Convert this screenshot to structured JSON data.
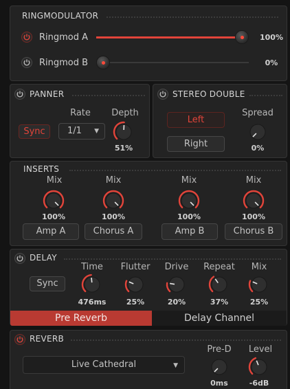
{
  "colors": {
    "accent": "#e2443a",
    "panel": "#232323",
    "background": "#141414",
    "text": "#c9c9c9"
  },
  "ringmod": {
    "title": "RINGMODULATOR",
    "a": {
      "label": "Ringmod A",
      "value_text": "100%",
      "level": 1.0,
      "power": "power-icon"
    },
    "b": {
      "label": "Ringmod B",
      "value_text": "0%",
      "level": 0.0,
      "power": "power-icon"
    }
  },
  "panner": {
    "title": "PANNER",
    "rate_label": "Rate",
    "depth_label": "Depth",
    "sync_label": "Sync",
    "rate_value": "1/1",
    "depth_value": "51%",
    "depth_level": 0.51
  },
  "stereo_double": {
    "title": "STEREO DOUBLE",
    "left_label": "Left",
    "right_label": "Right",
    "spread_label": "Spread",
    "spread_value": "0%",
    "spread_level": 0.0
  },
  "inserts": {
    "title": "INSERTS",
    "slots": [
      {
        "mix_label": "Mix",
        "mix_value": "100%",
        "level": 1.0,
        "name": "Amp A"
      },
      {
        "mix_label": "Mix",
        "mix_value": "100%",
        "level": 1.0,
        "name": "Chorus A"
      },
      {
        "mix_label": "Mix",
        "mix_value": "100%",
        "level": 1.0,
        "name": "Amp B"
      },
      {
        "mix_label": "Mix",
        "mix_value": "100%",
        "level": 1.0,
        "name": "Chorus B"
      }
    ]
  },
  "delay": {
    "title": "DELAY",
    "sync_label": "Sync",
    "params": [
      {
        "label": "Time",
        "value": "476ms",
        "level": 0.48
      },
      {
        "label": "Flutter",
        "value": "25%",
        "level": 0.25
      },
      {
        "label": "Drive",
        "value": "20%",
        "level": 0.2
      },
      {
        "label": "Repeat",
        "value": "37%",
        "level": 0.37
      },
      {
        "label": "Mix",
        "value": "25%",
        "level": 0.25
      }
    ]
  },
  "routing_tabs": [
    {
      "label": "Pre Reverb",
      "active": true
    },
    {
      "label": "Delay Channel",
      "active": false
    }
  ],
  "reverb": {
    "title": "REVERB",
    "preset": "Live Cathedral",
    "pred_label": "Pre-D",
    "pred_value": "0ms",
    "pred_level": 0.0,
    "level_label": "Level",
    "level_value": "-6dB",
    "level_level": 0.42
  }
}
